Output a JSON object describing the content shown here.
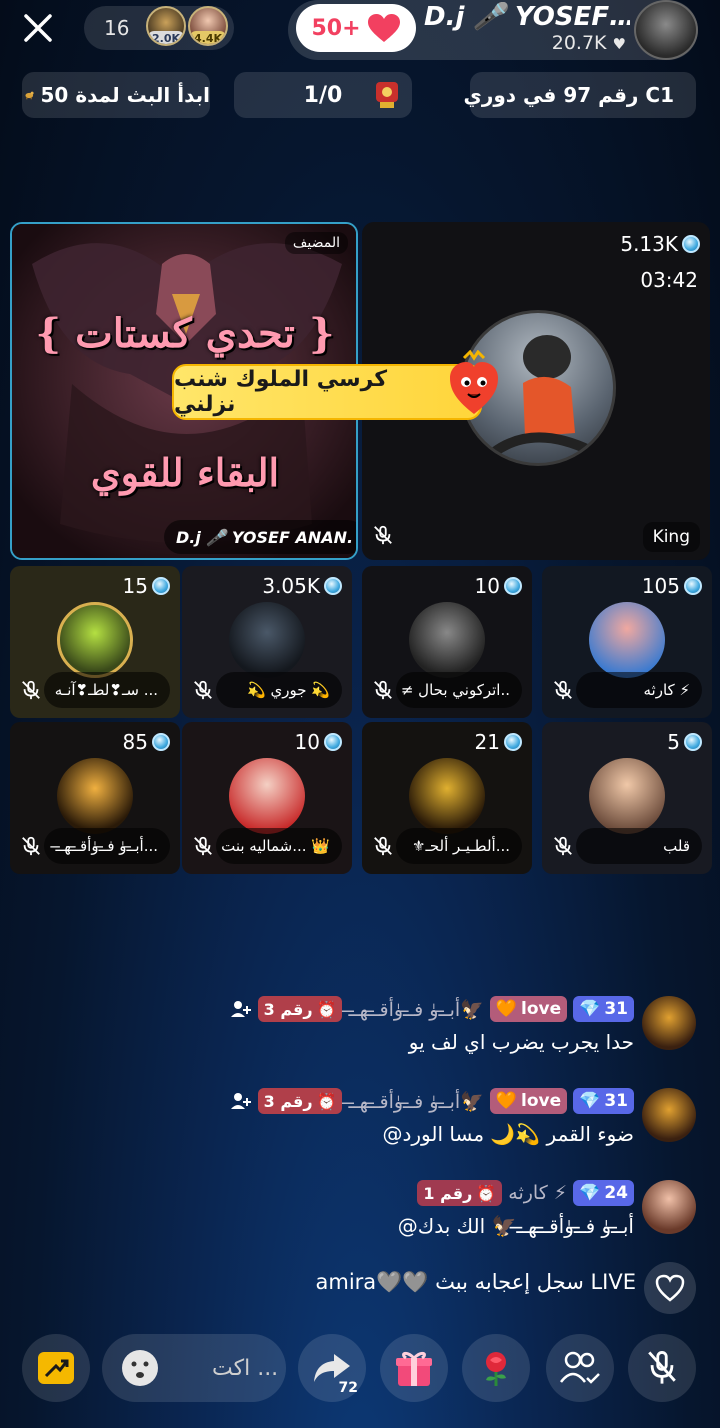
{
  "header": {
    "viewer_count": "16",
    "top_viewers": [
      {
        "badge": "2.0K",
        "badge_color": "#dcdcdc"
      },
      {
        "badge": "4.4K",
        "badge_color": "#e4c866"
      }
    ],
    "like_count": "50+",
    "host_name": "D.j 🎤 YOSEF…",
    "host_likes": "20.7K",
    "info_left": "ابدأ البث لمدة 50",
    "info_mid": "1/0",
    "info_right": "رقم 97 في دوري C1"
  },
  "stage": {
    "host_tag": "المضيف",
    "host_label": "D.j 🎤 YOSEF ANAN.",
    "poster_line1": "{ تحدي كستات }",
    "poster_line2": "البقاء للقوي",
    "king_score": "5.13K",
    "king_timer": "03:42",
    "king_label": "King",
    "banner_text": "كرسي الملوك شنب نزلني"
  },
  "seats": [
    {
      "score": "15",
      "label": "سـ❣لطـ❣آنـه ..."
    },
    {
      "score": "3.05K",
      "label": "💫 جوري 💫"
    },
    {
      "score": "10",
      "label": "≠ اتركوني بحال.."
    },
    {
      "score": "105",
      "label": "كارثه ⚡"
    },
    {
      "score": "85",
      "label": "أبـ̶ـﯛ فـ̶ـﯛأقـ̶ـهـ̶ـ..."
    },
    {
      "score": "10",
      "label": "شماليه بنت ا... 👑"
    },
    {
      "score": "21",
      "label": "⚜ألطـيـر ألحـ..."
    },
    {
      "score": "5",
      "label": "قلب"
    }
  ],
  "chat": [
    {
      "level": "31",
      "love": "love",
      "name": "أبـ̶ـﯛ فـ̶ـﯛأقـ̶ـهـ̶ـ🦅",
      "rank": "رقم 3",
      "message": "حدا يجرب يضرب اي لف يو"
    },
    {
      "level": "31",
      "love": "love",
      "name": "أبـ̶ـﯛ فـ̶ـﯛأقـ̶ـهـ̶ـ🦅",
      "rank": "رقم 3",
      "message": "@ضوء القمر 💫🌙 مسا الورد"
    },
    {
      "level": "24",
      "love": "",
      "name": "كارثه ⚡",
      "rank": "رقم 1",
      "message": "@أبـ̶ـﯛ فـ̶ـﯛأقـ̶ـهـ̶ـ🦅 الك  بدك"
    }
  ],
  "system_message": "amira🩶🩶 سجل إعجابه ببث LIVE",
  "bottom": {
    "input_placeholder": "اكت ...",
    "share_count": "72"
  },
  "colors": {
    "accent_blue": "#35a0c8",
    "like_red": "#f24060",
    "banner_yellow": "#ffd53a"
  }
}
